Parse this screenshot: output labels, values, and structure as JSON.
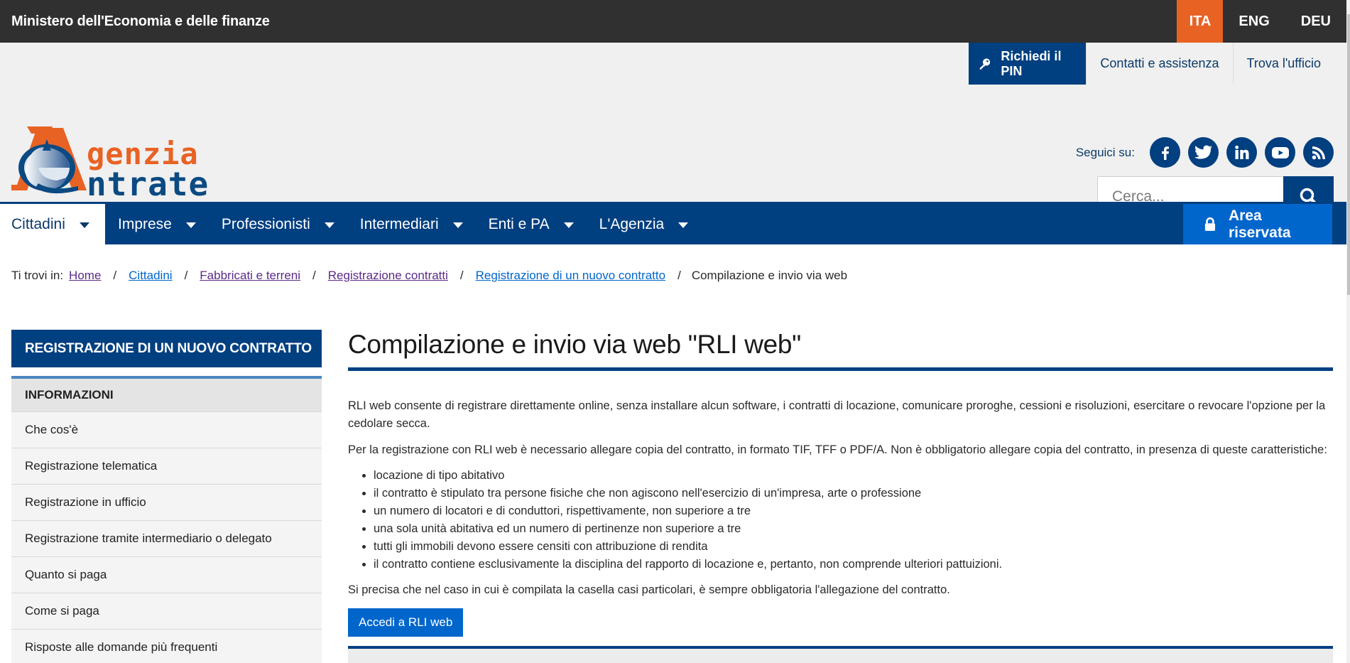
{
  "topbar": {
    "ministry": "Ministero dell'Economia e delle finanze",
    "languages": [
      {
        "label": "ITA",
        "active": true
      },
      {
        "label": "ENG",
        "active": false
      },
      {
        "label": "DEU",
        "active": false
      }
    ]
  },
  "logo": {
    "line1": "genzia",
    "line2": "ntrate",
    "alt": "Agenzia Entrate",
    "colors": {
      "orange": "#e86224",
      "blue": "#0b4a82"
    }
  },
  "utility": {
    "pin": {
      "label": "Richiedi il PIN",
      "icon": "key-icon"
    },
    "links": [
      "Contatti e assistenza",
      "Trova l'ufficio"
    ]
  },
  "social": {
    "label": "Seguici su:",
    "icons": [
      "facebook-icon",
      "twitter-icon",
      "linkedin-icon",
      "youtube-icon",
      "rss-icon"
    ]
  },
  "search": {
    "placeholder": "Cerca...",
    "value": "",
    "button_icon": "search-icon"
  },
  "nav": {
    "items": [
      {
        "label": "Cittadini",
        "active": true
      },
      {
        "label": "Imprese",
        "active": false
      },
      {
        "label": "Professionisti",
        "active": false
      },
      {
        "label": "Intermediari",
        "active": false
      },
      {
        "label": "Enti e PA",
        "active": false
      },
      {
        "label": "L'Agenzia",
        "active": false
      }
    ],
    "reserved": {
      "label": "Area riservata",
      "icon": "lock-icon"
    }
  },
  "breadcrumb": {
    "label": "Ti trovi in:",
    "links": [
      {
        "label": "Home",
        "visited": true
      },
      {
        "label": "Cittadini",
        "visited": false
      },
      {
        "label": "Fabbricati e terreni",
        "visited": true
      },
      {
        "label": "Registrazione contratti",
        "visited": true
      },
      {
        "label": "Registrazione di un nuovo contratto",
        "visited": false
      }
    ],
    "current": "Compilazione e invio via web"
  },
  "sidebar": {
    "title": "REGISTRAZIONE DI UN NUOVO CONTRATTO",
    "section": "INFORMAZIONI",
    "items": [
      "Che cos'è",
      "Registrazione telematica",
      "Registrazione in ufficio",
      "Registrazione tramite intermediario o delegato",
      "Quanto si paga",
      "Come si paga",
      "Risposte alle domande più frequenti"
    ]
  },
  "main": {
    "title": "Compilazione e invio via web \"RLI web\"",
    "paragraph1": "RLI web consente di registrare direttamente online, senza installare alcun software, i contratti di locazione, comunicare proroghe, cessioni e risoluzioni, esercitare o revocare l'opzione per la cedolare secca.",
    "paragraph2": "Per la registrazione con RLI web è necessario allegare copia del contratto, in formato TIF, TFF o PDF/A. Non è obbligatorio allegare copia del contratto, in presenza di queste caratteristiche:",
    "bullets": [
      "locazione di tipo abitativo",
      "il contratto è stipulato tra persone fisiche che non agiscono nell'esercizio di un'impresa, arte o professione",
      "un numero di locatori e di conduttori, rispettivamente, non superiore a tre",
      "una sola unità abitativa ed un numero di pertinenze non superiore a tre",
      "tutti gli immobili devono essere censiti con attribuzione di rendita",
      "il contratto contiene esclusivamente la disciplina del rapporto di locazione e, pertanto, non comprende ulteriori pattuizioni."
    ],
    "paragraph3": "Si precisa che nel caso in cui è compilata la casella casi particolari, è sempre obbligatoria l'allegazione del contratto.",
    "cta": "Accedi a RLI web"
  },
  "colors": {
    "dark_bar": "#303030",
    "accent_orange": "#e86224",
    "brand_blue": "#003f80",
    "action_blue": "#0066cc",
    "header_bg": "#f0f0f0"
  }
}
